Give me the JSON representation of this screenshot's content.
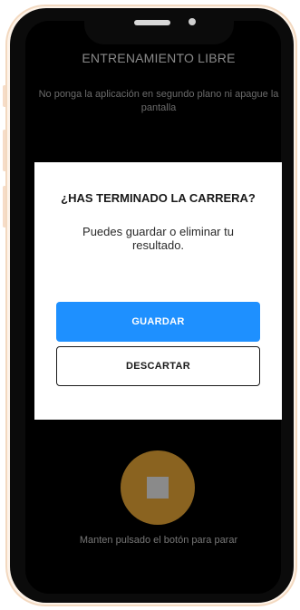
{
  "screen": {
    "title": "ENTRENAMIENTO LIBRE",
    "warning": "No ponga la aplicación en segundo plano ni apague la pantalla",
    "hold_instruction": "Manten pulsado el botón para parar"
  },
  "dialog": {
    "title": "¿HAS TERMINADO LA CARRERA?",
    "message": "Puedes guardar o eliminar tu resultado.",
    "save_label": "GUARDAR",
    "discard_label": "DESCARTAR"
  },
  "icons": {
    "stop": "stop-icon"
  },
  "colors": {
    "primary_button": "#1e90ff",
    "stop_button": "#8a6320",
    "frame": "#fdf3e9"
  }
}
